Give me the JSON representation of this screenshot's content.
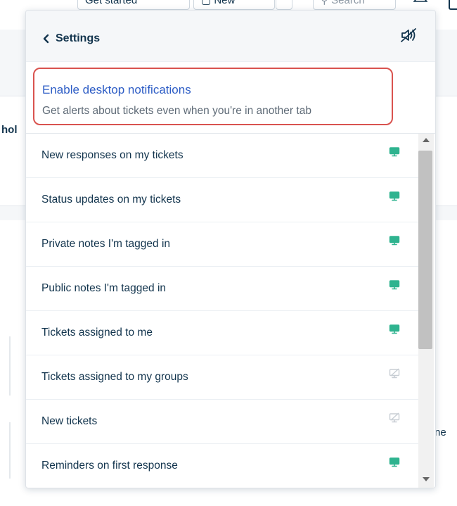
{
  "background": {
    "get_started_label": "Get started",
    "new_label": "New",
    "search_label": "Search",
    "partial_left_text": "hol",
    "partial_right_text": "ne"
  },
  "panel": {
    "back_label": "Settings",
    "mute_icon": "speaker-muted-icon",
    "enable": {
      "title": "Enable desktop notifications",
      "subtitle": "Get alerts about tickets even when you're in another tab",
      "highlight_color": "#d9534f"
    },
    "items": [
      {
        "label": "New responses on my tickets",
        "enabled": true
      },
      {
        "label": "Status updates on my tickets",
        "enabled": true
      },
      {
        "label": "Private notes I'm tagged in",
        "enabled": true
      },
      {
        "label": "Public notes I'm tagged in",
        "enabled": true
      },
      {
        "label": "Tickets assigned to me",
        "enabled": true
      },
      {
        "label": "Tickets assigned to my groups",
        "enabled": false
      },
      {
        "label": "New tickets",
        "enabled": false
      },
      {
        "label": "Reminders on first response",
        "enabled": true
      }
    ],
    "colors": {
      "enabled_icon": "#2fb38f",
      "disabled_icon": "#c8ced4",
      "link": "#2c5cc5"
    }
  }
}
